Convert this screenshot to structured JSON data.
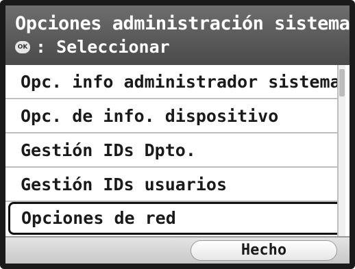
{
  "header": {
    "title": "Opciones administración sistema",
    "ok_icon_label": "OK",
    "hint": ": Seleccionar"
  },
  "menu": {
    "items": [
      {
        "label": "Opc. info administrador sistema"
      },
      {
        "label": "Opc. de info. dispositivo"
      },
      {
        "label": "Gestión IDs Dpto."
      },
      {
        "label": "Gestión IDs usuarios"
      },
      {
        "label": "Opciones de red",
        "selected": true
      }
    ]
  },
  "footer": {
    "done_label": "Hecho"
  },
  "colors": {
    "header_top": "#6e6e6e",
    "header_bottom": "#4a4a4a",
    "frame": "#1a1a1a",
    "footer": "#d6d6d6"
  },
  "icons": {
    "ok": "ok-button-icon"
  }
}
